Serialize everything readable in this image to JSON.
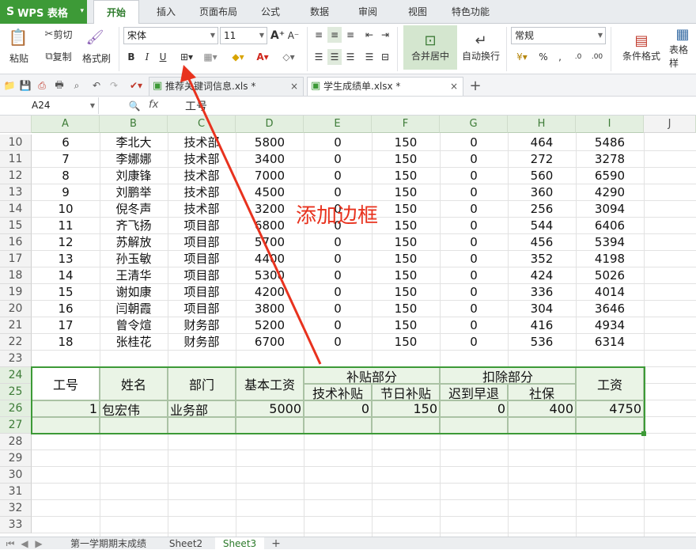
{
  "menubar": {
    "app_name": "WPS 表格",
    "tabs": [
      "开始",
      "插入",
      "页面布局",
      "公式",
      "数据",
      "审阅",
      "视图",
      "特色功能"
    ]
  },
  "ribbon": {
    "paste": "粘贴",
    "cut": "剪切",
    "copy": "复制",
    "format_painter": "格式刷",
    "font_name": "宋体",
    "font_size": "11",
    "merge_center": "合并居中",
    "wrap_text": "自动换行",
    "number_format": "常规",
    "conditional_format": "条件格式",
    "table_style": "表格样"
  },
  "tabs": {
    "doc1": "推荐关键词信息.xls *",
    "doc2": "学生成绩单.xlsx *"
  },
  "formula": {
    "cell_ref": "A24",
    "fx": "fx",
    "content": "工号"
  },
  "columns": [
    "A",
    "B",
    "C",
    "D",
    "E",
    "F",
    "G",
    "H",
    "I",
    "J"
  ],
  "rows": [
    [
      "6",
      "李北大",
      "技术部",
      "5800",
      "0",
      "150",
      "0",
      "464",
      "5486"
    ],
    [
      "7",
      "李娜娜",
      "技术部",
      "3400",
      "0",
      "150",
      "0",
      "272",
      "3278"
    ],
    [
      "8",
      "刘康锋",
      "技术部",
      "7000",
      "0",
      "150",
      "0",
      "560",
      "6590"
    ],
    [
      "9",
      "刘鹏举",
      "技术部",
      "4500",
      "0",
      "150",
      "0",
      "360",
      "4290"
    ],
    [
      "10",
      "倪冬声",
      "技术部",
      "3200",
      "0",
      "150",
      "0",
      "256",
      "3094"
    ],
    [
      "11",
      "齐飞扬",
      "项目部",
      "6800",
      "0",
      "150",
      "0",
      "544",
      "6406"
    ],
    [
      "12",
      "苏解放",
      "项目部",
      "5700",
      "0",
      "150",
      "0",
      "456",
      "5394"
    ],
    [
      "13",
      "孙玉敏",
      "项目部",
      "4400",
      "0",
      "150",
      "0",
      "352",
      "4198"
    ],
    [
      "14",
      "王清华",
      "项目部",
      "5300",
      "0",
      "150",
      "0",
      "424",
      "5026"
    ],
    [
      "15",
      "谢如康",
      "项目部",
      "4200",
      "0",
      "150",
      "0",
      "336",
      "4014"
    ],
    [
      "16",
      "闫朝霞",
      "项目部",
      "3800",
      "0",
      "150",
      "0",
      "304",
      "3646"
    ],
    [
      "17",
      "曾令煊",
      "财务部",
      "5200",
      "0",
      "150",
      "0",
      "416",
      "4934"
    ],
    [
      "18",
      "张桂花",
      "财务部",
      "6700",
      "0",
      "150",
      "0",
      "536",
      "6314"
    ]
  ],
  "row_numbers": [
    "10",
    "11",
    "12",
    "13",
    "14",
    "15",
    "16",
    "17",
    "18",
    "19",
    "20",
    "21",
    "22",
    "23",
    "24",
    "25",
    "26",
    "27",
    "28",
    "29",
    "30",
    "31",
    "32",
    "33"
  ],
  "salary_table": {
    "h_id": "工号",
    "h_name": "姓名",
    "h_dept": "部门",
    "h_base": "基本工资",
    "h_allow": "补贴部分",
    "h_deduct": "扣除部分",
    "h_total": "工资",
    "h_tech": "技术补贴",
    "h_holiday": "节日补贴",
    "h_late": "迟到早退",
    "h_social": "社保",
    "row": [
      "1",
      "包宏伟",
      "业务部",
      "5000",
      "0",
      "150",
      "0",
      "400",
      "4750"
    ]
  },
  "annotation": "添加边框",
  "sheets": [
    "第一学期期末成绩",
    "Sheet2",
    "Sheet3"
  ],
  "colors": {
    "accent": "#3d9a37",
    "annotation": "#e8321e",
    "header_green": "#e3efe0"
  }
}
